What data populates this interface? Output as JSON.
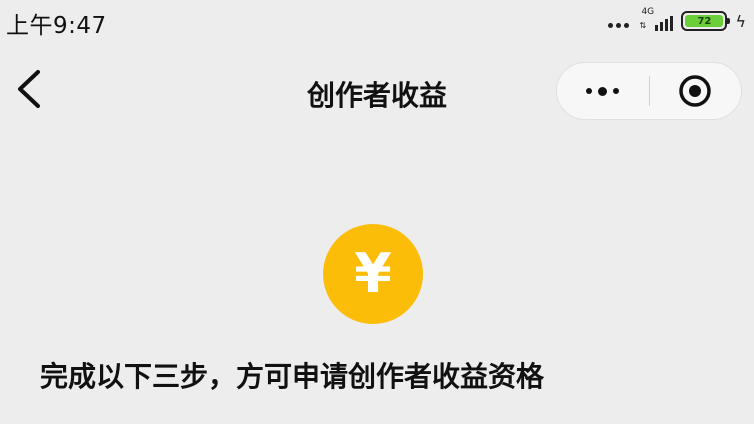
{
  "status_bar": {
    "time": "上午9:47",
    "network": "4G",
    "battery_level": "72",
    "battery_color": "#6ccf3a"
  },
  "nav": {
    "title": "创作者收益",
    "back_icon": "chevron-left-icon",
    "more_icon": "more-dots-icon",
    "close_icon": "target-close-icon"
  },
  "content": {
    "coin_symbol": "¥",
    "coin_color": "#fbbd08",
    "headline": "完成以下三步，方可申请创作者收益资格"
  }
}
